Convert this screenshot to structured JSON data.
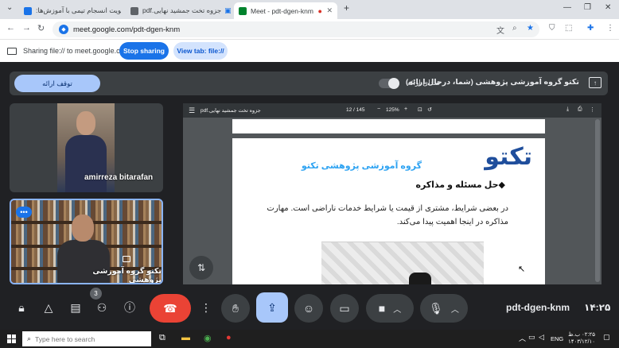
{
  "browser": {
    "tabs": [
      {
        "title": "تقویت انسجام تیمی با آموزش‌ها:",
        "active": false
      },
      {
        "title": "pdf.جزوه تخت جمشید نهایی",
        "active": false
      },
      {
        "title": "Meet - pdt-dgen-knm",
        "active": true
      }
    ],
    "new_tab": "+",
    "url": "meet.google.com/pdt-dgen-knm"
  },
  "share_bar": {
    "text": "Sharing file:// to meet.google.com",
    "stop_label": "Stop sharing",
    "view_label": "View tab: file://"
  },
  "presentation_bar": {
    "pause_label": "توقف ارائه",
    "audio_label": "صدای ارائه",
    "title": "تکتو گروه آموزشی پژوهشی (شما، درحال ارائه)"
  },
  "participants": {
    "tile1_name": "amirreza bitarafan",
    "tile2_name": "تکتو گروه آموزشی پژوهشی",
    "count": "3"
  },
  "pdf": {
    "file_name": "جزوه تخت جمشید نهایی.pdf",
    "page": "12  /  145",
    "zoom": "125%",
    "logo": "تکتو",
    "org": "گروه آموزشی پژوهشی تکتو",
    "heading": "◆حل مسئله و مذاکره",
    "paragraph": "در بعضی شرایط، مشتری از قیمت یا شرایط خدمات ناراضی است. مهارت مذاکره در اینجا اهمیت پیدا می‌کند."
  },
  "meeting": {
    "code": "pdt-dgen-knm",
    "time": "۱۴:۲۵"
  },
  "taskbar": {
    "search_placeholder": "Type here to search",
    "language": "ENG",
    "time": "۰۲:۲۵ ب.ظ",
    "date": "۱۴۰۳/۱۲/۱۰"
  },
  "colors": {
    "accent": "#1a73e8",
    "end_call": "#ea4335",
    "present_active": "#a8c7fa",
    "meet_bg": "#202124"
  }
}
